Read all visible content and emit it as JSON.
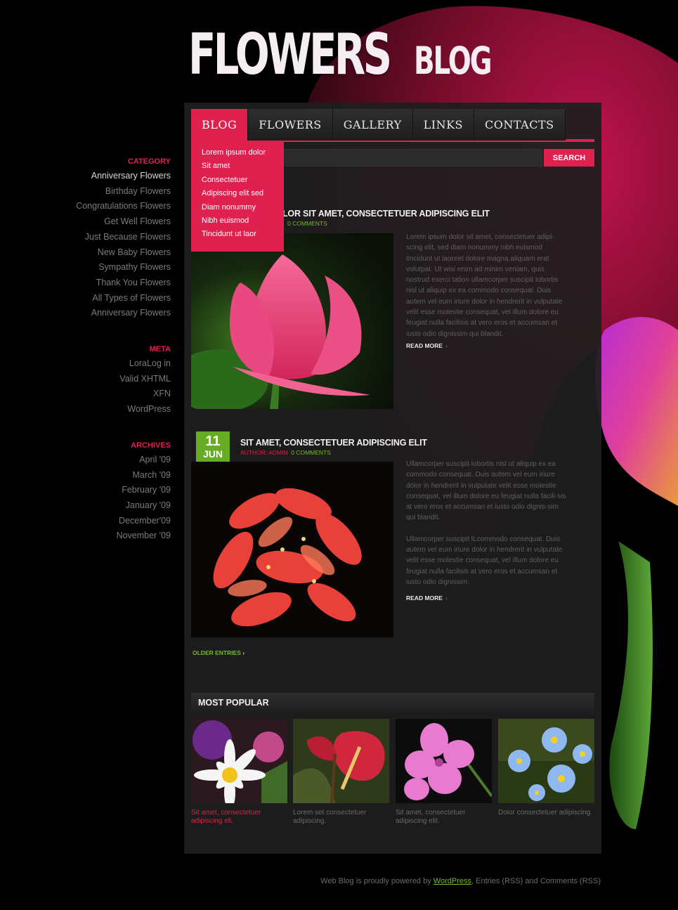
{
  "logo": {
    "big": "FLOWERS",
    "small": "BLOG"
  },
  "nav": [
    {
      "label": "BLOG"
    },
    {
      "label": "FLOWERS"
    },
    {
      "label": "GALLERY"
    },
    {
      "label": "LINKS"
    },
    {
      "label": "CONTACTS"
    }
  ],
  "search": {
    "placeholder": "re",
    "button": "SEARCH"
  },
  "dropdown": [
    "Lorem ipsum dolor",
    "Sit amet",
    "Consectetuer",
    "Adipiscing elit sed",
    "Diam nonummy",
    "Nibh euismod",
    "Tincidunt ut laor"
  ],
  "posts": [
    {
      "title": "LOR SIT AMET, CONSECTETUER ADIPISCING ELIT",
      "author_prefix": "",
      "author_sep": ":",
      "comments": "0 COMMENTS",
      "text": "Lorem ipsum dolor sit amet, consectetuer adipi-scing elit, sed diam nonummy nibh euismod tincidunt ut laoreet dolore magna aliquam erat volutpat. Ut wisi enim ad minim veniam, quis nostrud exerci tation ullamcorper suscipit lobortis nisl ut aliquip ex ea commodo consequat. Duis autem vel eum iriure dolor in hendrerit in vulputate velit esse molestie consequat, vel illum dolore eu feugiat nulla facilisis at vero eros et accumsan et iusto odio dignissim qui blandit.",
      "read_more": "READ MORE"
    },
    {
      "day": "11",
      "month": "JUN",
      "title": "SIT AMET, CONSECTETUER ADIPISCING ELIT",
      "author": "AUTHOR: ADMIN",
      "comments": "0 COMMENTS",
      "text1": "Ullamcorper suscipit lobortis nisl ut aliquip ex ea commodo consequat. Duis autem vel eum iriure dolor in hendrerit in vulputate velit esse molestie consequat, vel illum dolore eu feugiat nulla facili-sis at vero eros et accumsan et iusto odio dignis-sim qui blandit.",
      "text2": "Ullamcorper suscipit lLcommodo consequat. Duis autem vel eum iriure dolor in hendrerit in vulputate velit esse molestie consequat, vel illum dolore eu feugiat nulla facilisis at vero eros et accumsan et iusto odio dignissim.",
      "read_more": "READ MORE"
    }
  ],
  "older_entries": "OLDER ENTRIES",
  "popular": {
    "title": "MOST POPULAR",
    "items": [
      {
        "caption": "Sit amet, consectetuer adipiscing eli."
      },
      {
        "caption": "Lorem set consectetuer adipiscing."
      },
      {
        "caption": "Sit amet, consectetuer adipiscing elit."
      },
      {
        "caption": "Dolor  consectetuer adipiscing."
      }
    ]
  },
  "sidebar": {
    "category": {
      "title": "CATEGORY",
      "items": [
        "Anniversary Flowers",
        "Birthday Flowers",
        "Congratulations Flowers",
        "Get Well Flowers",
        "Just Because Flowers",
        "New Baby Flowers",
        "Sympathy Flowers",
        "Thank You Flowers",
        "All Types of Flowers",
        "Anniversary Flowers"
      ]
    },
    "meta": {
      "title": "META",
      "items": [
        "LoraLog in",
        "Valid XHTML",
        "XFN",
        "WordPress"
      ]
    },
    "archives": {
      "title": "ARCHIVES",
      "items": [
        "April '09",
        "March '09",
        "February '09",
        "January '09",
        "December'09",
        "November '09"
      ]
    }
  },
  "footer": {
    "prefix": "Web Blog is proudly powered by",
    "link": "WordPress",
    "suffix": ", Entries (RSS) and Comments (RSS)"
  },
  "colors": {
    "accent": "#e0204e",
    "green": "#67ad24",
    "panel": "#1e1e1e"
  }
}
